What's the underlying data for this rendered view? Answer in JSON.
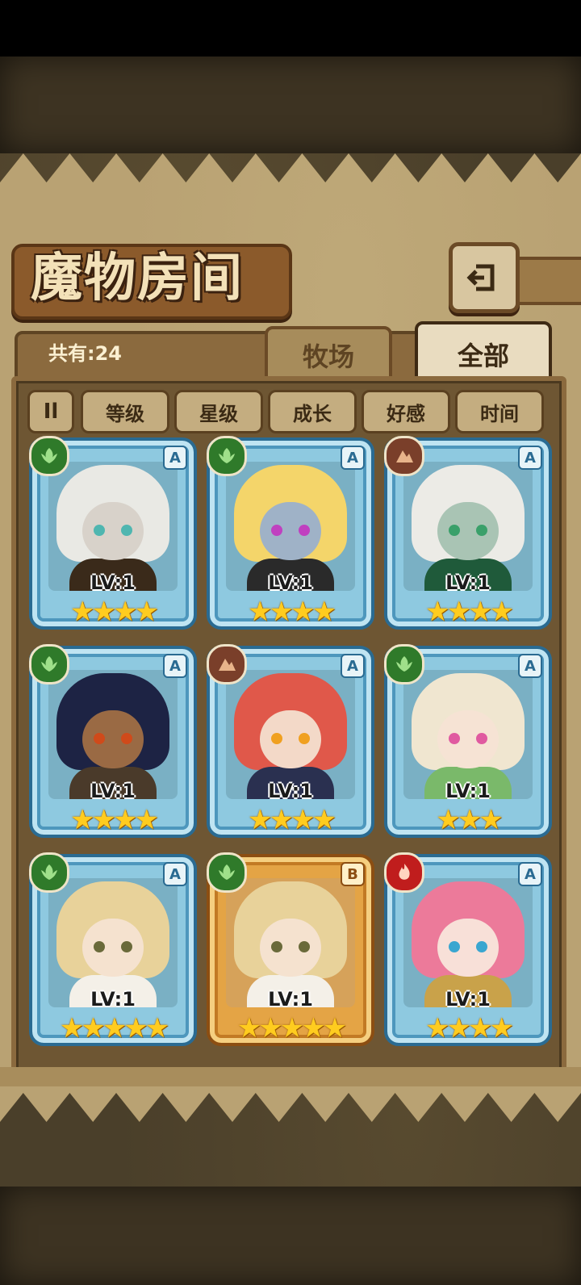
{
  "header": {
    "title": "魔物房间",
    "back_icon": "return-arrow-icon"
  },
  "summary": {
    "count_label": "共有:24"
  },
  "tabs": [
    {
      "label": "牧场",
      "selected": false
    },
    {
      "label": "全部",
      "selected": true
    }
  ],
  "sort": {
    "toggle_label": "Il",
    "buttons": [
      "等级",
      "星级",
      "成长",
      "好感",
      "时间"
    ]
  },
  "monsters": [
    {
      "level": "LV:1",
      "stars": "★★★★",
      "star_count": 4,
      "grade": "A",
      "element": "leaf",
      "frame": "blue",
      "hair": "#e9e9e4",
      "skin": "#d8d2ca",
      "eye": "#4fb6b0",
      "outfit": "#3a2a1a"
    },
    {
      "level": "LV:1",
      "stars": "★★★★",
      "star_count": 4,
      "grade": "A",
      "element": "leaf",
      "frame": "blue",
      "hair": "#f4d56a",
      "skin": "#9fb2c7",
      "eye": "#c040c0",
      "outfit": "#2a2a2a"
    },
    {
      "level": "LV:1",
      "stars": "★★★★",
      "star_count": 4,
      "grade": "A",
      "element": "earth",
      "frame": "blue",
      "hair": "#ecebe6",
      "skin": "#a9c4b4",
      "eye": "#3aa06a",
      "outfit": "#1f5a3a"
    },
    {
      "level": "LV:1",
      "stars": "★★★★",
      "star_count": 4,
      "grade": "A",
      "element": "leaf",
      "frame": "blue",
      "hair": "#1d2344",
      "skin": "#9a6a44",
      "eye": "#d04a1a",
      "outfit": "#4a3a2a"
    },
    {
      "level": "LV:1",
      "stars": "★★★★",
      "star_count": 4,
      "grade": "A",
      "element": "earth",
      "frame": "blue",
      "hair": "#e0584a",
      "skin": "#f3d9c8",
      "eye": "#f0a020",
      "outfit": "#2a3050"
    },
    {
      "level": "LV:1",
      "stars": "★★★",
      "star_count": 3,
      "grade": "A",
      "element": "leaf",
      "frame": "blue",
      "hair": "#f0e6d0",
      "skin": "#f6e3d4",
      "eye": "#e05aa0",
      "outfit": "#7ab96a"
    },
    {
      "level": "LV:1",
      "stars": "★★★★★",
      "star_count": 5,
      "grade": "A",
      "element": "leaf",
      "frame": "blue",
      "hair": "#e8d29a",
      "skin": "#f5e2cf",
      "eye": "#6a6a3a",
      "outfit": "#f4f0e8"
    },
    {
      "level": "LV:1",
      "stars": "★★★★★",
      "star_count": 5,
      "grade": "B",
      "element": "leaf",
      "frame": "gold",
      "hair": "#e8d29a",
      "skin": "#f5e2cf",
      "eye": "#6a6a3a",
      "outfit": "#f4f0e8"
    },
    {
      "level": "LV:1",
      "stars": "★★★★",
      "star_count": 4,
      "grade": "A",
      "element": "fire",
      "frame": "blue",
      "hair": "#ec7a9a",
      "skin": "#f8e0d8",
      "eye": "#3aa6d0",
      "outfit": "#c9a24a"
    }
  ]
}
